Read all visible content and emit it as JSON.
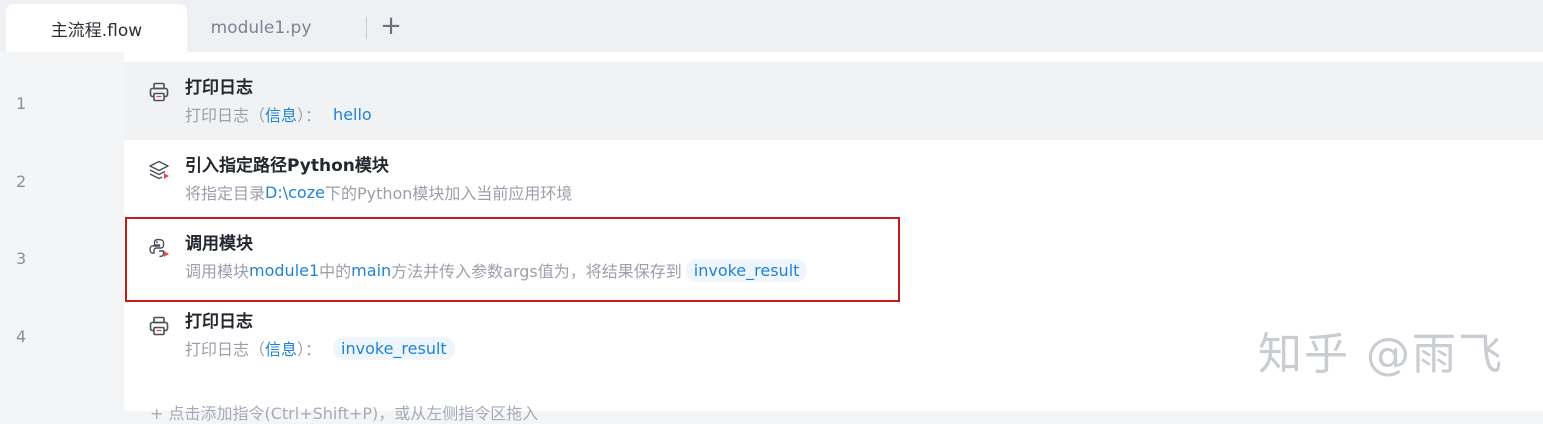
{
  "tabs": [
    {
      "label": "主流程.flow",
      "active": true
    },
    {
      "label": "module1.py",
      "active": false
    }
  ],
  "add_tab_symbol": "+",
  "lines": [
    "1",
    "2",
    "3",
    "4"
  ],
  "steps": [
    {
      "icon": "printer-icon",
      "title": "打印日志",
      "desc": {
        "pre": "打印日志（",
        "kw1": "信息",
        "mid": "）：",
        "kw2": "hello"
      }
    },
    {
      "icon": "layers-icon",
      "title": "引入指定路径Python模块",
      "desc": {
        "pre": "将指定目录",
        "kw1": "D:\\coze",
        "mid": "下的Python模块加入当前应用环境"
      }
    },
    {
      "icon": "python-icon",
      "title": "调用模块",
      "desc": {
        "pre": "调用模块",
        "kw1": "module1",
        "mid": "中的",
        "kw2": "main",
        "post": "方法并传入参数args值为，将结果保存到",
        "chip": "invoke_result"
      }
    },
    {
      "icon": "printer-icon",
      "title": "打印日志",
      "desc": {
        "pre": "打印日志（",
        "kw1": "信息",
        "mid": "）：",
        "chip": "invoke_result"
      }
    }
  ],
  "add_hint": "+ 点击添加指令(Ctrl+Shift+P)，或从左侧指令区拖入",
  "watermark": "知乎 @雨飞",
  "colors": {
    "keyword": "#1f83d6",
    "selection": "#c41a1a",
    "highlight_row": "#f1f2f4"
  }
}
